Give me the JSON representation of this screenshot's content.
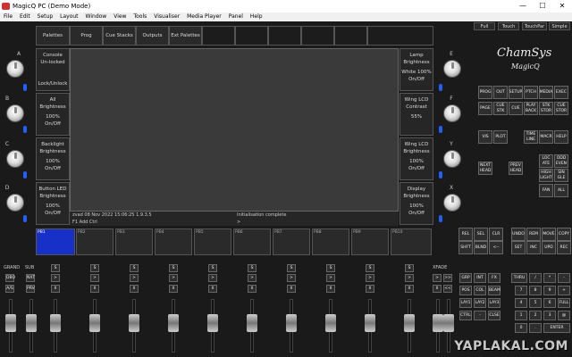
{
  "window": {
    "title": "MagicQ PC (Demo Mode)",
    "min": "—",
    "max": "☐",
    "close": "✕"
  },
  "menu": [
    "File",
    "Edit",
    "Setup",
    "Layout",
    "Window",
    "View",
    "Tools",
    "Visualiser",
    "Media Player",
    "Panel",
    "Help"
  ],
  "tabs": [
    "Palettes",
    "Prog",
    "Cue Stacks",
    "Outputs",
    "Ext Palettes",
    "",
    "",
    "",
    "",
    "",
    ""
  ],
  "mode_tabs": [
    "Full",
    "Touch",
    "TouchPar",
    "Simple"
  ],
  "encoders": {
    "left": [
      "A",
      "B",
      "C",
      "D"
    ],
    "right": [
      "E",
      "F",
      "Y",
      "X"
    ]
  },
  "left_softkeys": [
    {
      "l1": "Console",
      "l2": "Un-locked",
      "l3": "Lock/Unlock",
      "v": ""
    },
    {
      "l1": "All",
      "l2": "Brightness",
      "v": "100%",
      "sub": "On/Off"
    },
    {
      "l1": "Backlight",
      "l2": "Brightness",
      "v": "100%",
      "sub": "On/Off"
    },
    {
      "l1": "Button LED",
      "l2": "Brightness",
      "v": "100%",
      "sub": "On/Off"
    }
  ],
  "right_softkeys": [
    {
      "l1": "Lamp",
      "l2": "Brightness",
      "v": "White 100%",
      "sub": "On/Off"
    },
    {
      "l1": "Wing LCD",
      "l2": "Contrast",
      "v": "55%",
      "sub": ""
    },
    {
      "l1": "Wing LCD",
      "l2": "Brightness",
      "v": "100%",
      "sub": "On/Off"
    },
    {
      "l1": "Display",
      "l2": "Brightness",
      "v": "100%",
      "sub": "On/Off"
    }
  ],
  "status": {
    "left1": "zvad 08 Nov 2022 15:06:25 1.9.3.5",
    "left2": "F1  Add Ctrl",
    "right1": "Initialisation complete",
    "right2": ">"
  },
  "playbacks": [
    "PB1",
    "PB2",
    "PB3",
    "PB4",
    "PB5",
    "PB6",
    "PB7",
    "PB8",
    "PB9",
    "PB10"
  ],
  "logo": {
    "l1": "ChamSys",
    "l2": "MagicQ"
  },
  "keys1": [
    "PROG",
    "OUT",
    "SETUP",
    "PTCH",
    "MEDIA",
    "EXEC"
  ],
  "keys2": [
    "PAGE",
    "CUE STK",
    "CUE",
    "PLAY BACK",
    "STK STOR",
    "CUE STOR"
  ],
  "keys3": [
    "VIS",
    "PLOT",
    "",
    "TIME LINE",
    "MACR",
    "HELP"
  ],
  "keys4": [
    "LOC ATE",
    "ODD EVEN"
  ],
  "keys5": [
    "NEXT HEAD",
    "PREV HEAD",
    "HIGH LIGHT",
    "SIN GLE"
  ],
  "keys6": [
    "FAN",
    "ALL"
  ],
  "keys7": [
    "REL",
    "SEL",
    "CLR",
    "UNDO",
    "REM",
    "MOVE",
    "COPY"
  ],
  "keys8": [
    "SHFT",
    "BLND",
    "<--",
    "SET",
    "INC",
    "UPD",
    "REC"
  ],
  "fader_section": {
    "grand": "GRAND",
    "sub": "SUB",
    "xfade": "XFADE",
    "dbo": "DBO",
    "nxt": "NXT",
    "as": "A/S",
    "prv": "PRV",
    "s": "S",
    "gt": ">",
    "pause": "ll",
    "dbl": ">>",
    "dbl2": "<<"
  },
  "prog_keys": [
    "GRP",
    "INT",
    "FX",
    "POS",
    "COL",
    "BEAM",
    "LAY1",
    "LAY2",
    "LAY3",
    "CTRL",
    "-",
    "CLSE"
  ],
  "keypad": [
    "THRU",
    "/",
    "*",
    "-",
    "7",
    "8",
    "9",
    "+",
    "4",
    "5",
    "6",
    "FULL",
    "1",
    "2",
    "3",
    "@",
    "0",
    ".",
    "ENTER"
  ],
  "watermark": "YAPLAKAL.COM",
  "colors": {
    "accent": "#1730c8",
    "bg": "#1a1a1a"
  }
}
